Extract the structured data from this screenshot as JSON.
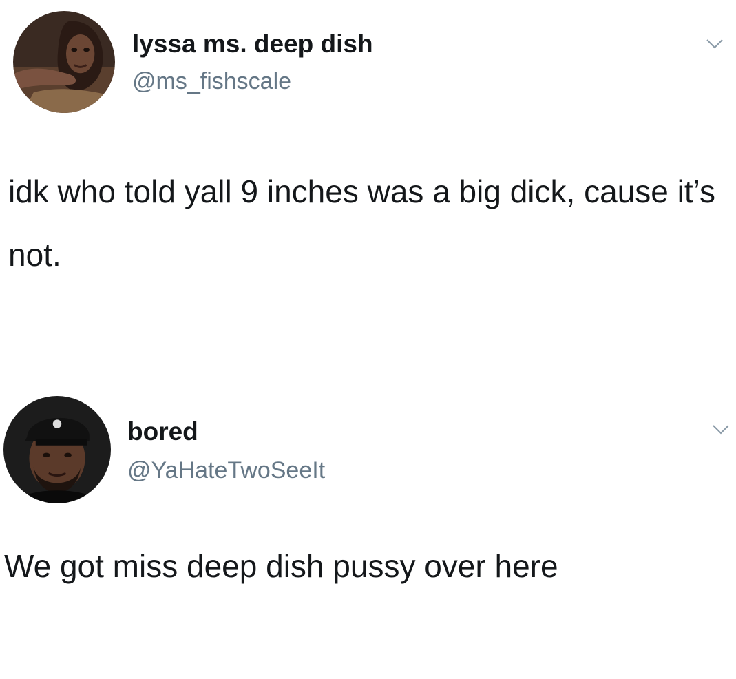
{
  "tweets": [
    {
      "display_name": "lyssa ms. deep dish",
      "handle": "@ms_fishscale",
      "text": "idk who told yall 9 inches was a big dick, cause it’s not.",
      "avatar_icon": "profile-photo-woman",
      "menu_icon": "chevron-down-icon"
    },
    {
      "display_name": "bored",
      "handle": "@YaHateTwoSeeIt",
      "text": "We got miss deep dish pussy over here",
      "avatar_icon": "profile-photo-man-cap",
      "menu_icon": "chevron-down-icon"
    }
  ],
  "colors": {
    "name": "#14171a",
    "handle": "#657786",
    "text": "#14171a",
    "chevron": "#8899a6",
    "background": "#ffffff"
  }
}
